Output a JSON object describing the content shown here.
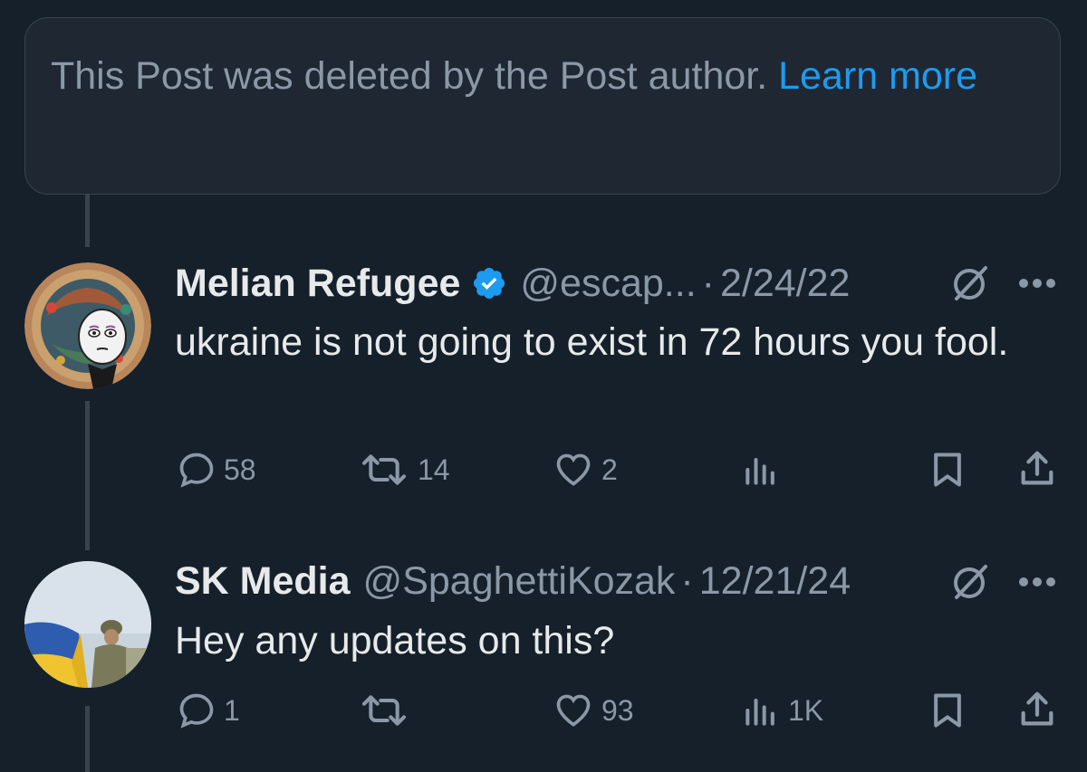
{
  "deleted_notice": {
    "text": "This Post was deleted by the Post author.",
    "link": "Learn more"
  },
  "posts": [
    {
      "name": "Melian Refugee",
      "verified": true,
      "handle": "@escap...",
      "separator": "·",
      "date": "2/24/22",
      "text": "ukraine is not going to exist in 72 hours you fool.",
      "actions": {
        "replies": "58",
        "reposts": "14",
        "likes": "2",
        "views": ""
      }
    },
    {
      "name": "SK Media",
      "verified": false,
      "handle": "@SpaghettiKozak",
      "separator": "·",
      "date": "12/21/24",
      "text": "Hey any updates on this?",
      "actions": {
        "replies": "1",
        "reposts": "",
        "likes": "93",
        "views": "1K"
      }
    }
  ],
  "colors": {
    "background": "#15202b",
    "accent": "#1d9bf0",
    "muted": "#8b98a5",
    "text": "#e7e9ea"
  },
  "icons": [
    "verified-badge-icon",
    "edited-icon",
    "more-icon",
    "reply-icon",
    "repost-icon",
    "like-icon",
    "views-icon",
    "bookmark-icon",
    "share-icon"
  ]
}
